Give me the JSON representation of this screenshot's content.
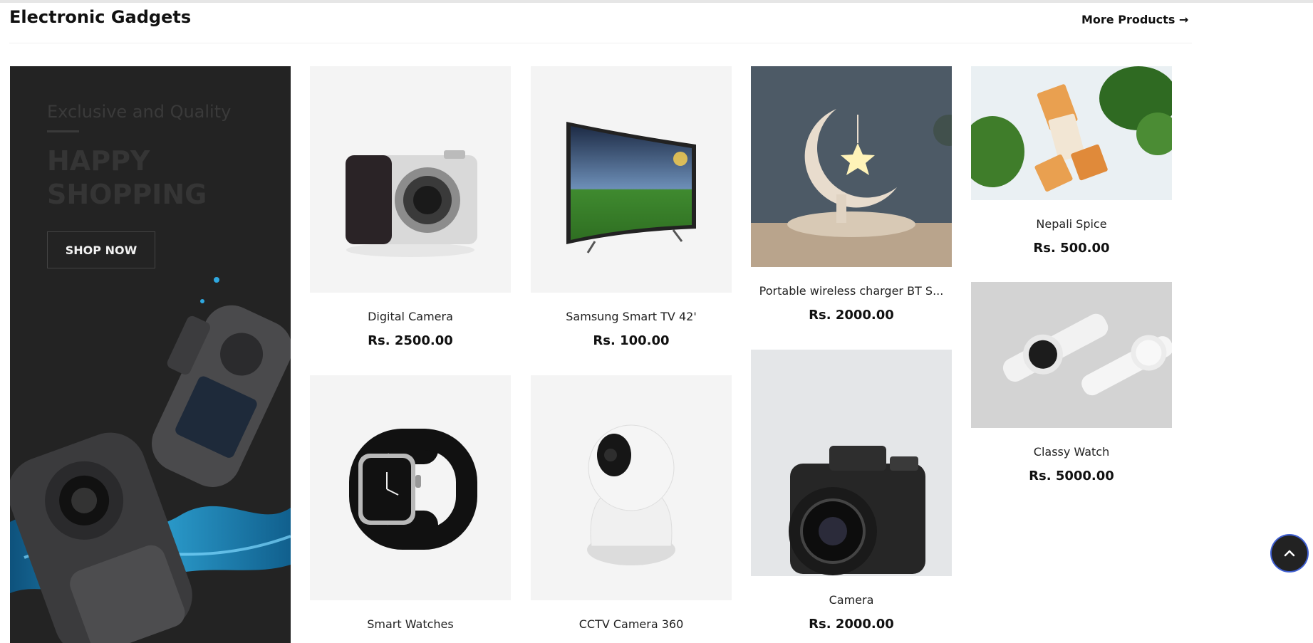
{
  "section": {
    "title": "Electronic Gadgets",
    "more_link": "More Products →"
  },
  "banner": {
    "eyebrow": "Exclusive and Quality",
    "headline": "HAPPY\nSHOPPING",
    "cta_label": "SHOP NOW"
  },
  "products": [
    {
      "name": "Digital Camera",
      "price": "Rs. 2500.00"
    },
    {
      "name": "Samsung Smart TV 42'",
      "price": "Rs. 100.00"
    },
    {
      "name": "Portable wireless charger BT S...",
      "price": "Rs. 2000.00"
    },
    {
      "name": "Nepali Spice",
      "price": "Rs. 500.00"
    },
    {
      "name": "Smart Watches",
      "price": ""
    },
    {
      "name": "CCTV Camera 360",
      "price": ""
    },
    {
      "name": "Camera",
      "price": "Rs. 2000.00"
    },
    {
      "name": "Classy Watch",
      "price": "Rs. 5000.00"
    }
  ],
  "icons": {
    "scroll_top": "chevron-up-icon"
  },
  "colors": {
    "banner_bg": "#232323",
    "accent_ring": "#3f5fd1"
  }
}
